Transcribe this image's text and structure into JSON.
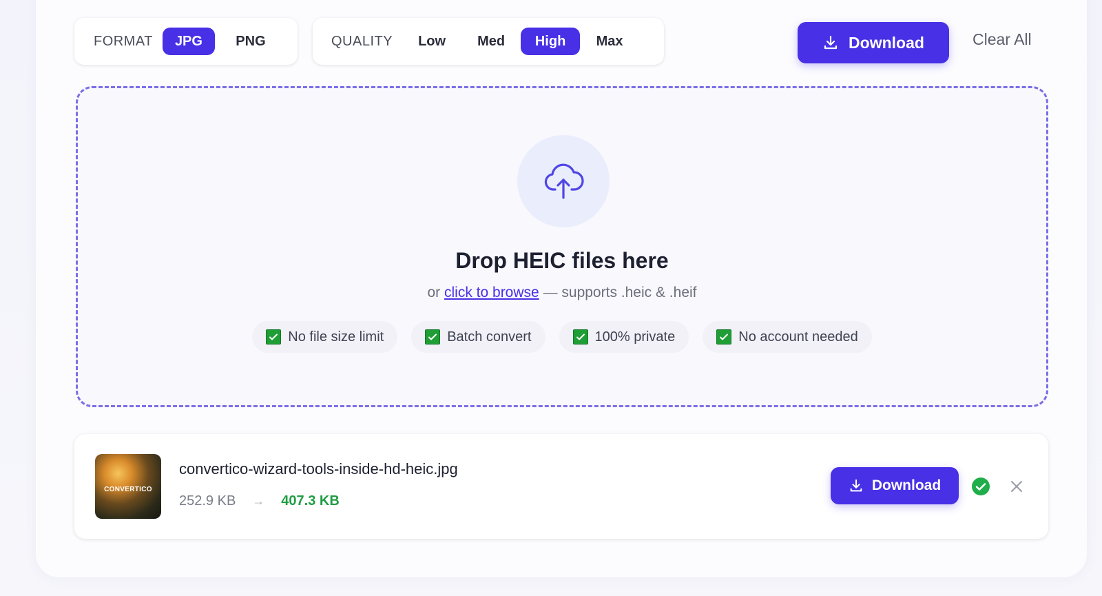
{
  "format": {
    "label": "FORMAT",
    "options": [
      "JPG",
      "PNG"
    ],
    "selected": "JPG"
  },
  "quality": {
    "label": "QUALITY",
    "options": [
      "Low",
      "Med",
      "High",
      "Max"
    ],
    "selected": "High"
  },
  "toolbar": {
    "download_label": "Download",
    "clear_label": "Clear All"
  },
  "dropzone": {
    "icon": "cloud-upload-icon",
    "title": "Drop HEIC files here",
    "sub_prefix": "or",
    "browse_link": "click to browse",
    "sub_suffix": "— supports .heic & .heif",
    "features": [
      "No file size limit",
      "Batch convert",
      "100% private",
      "No account needed"
    ]
  },
  "files": [
    {
      "thumb_text": "CONVERTICO",
      "name": "convertico-wizard-tools-inside-hd-heic.jpg",
      "original_size": "252.9 KB",
      "arrow": "→",
      "converted_size": "407.3 KB",
      "download_label": "Download",
      "status": "done"
    }
  ],
  "colors": {
    "accent": "#4730e6",
    "success": "#1f9d44",
    "dropzone_border": "#7b6ee6"
  }
}
